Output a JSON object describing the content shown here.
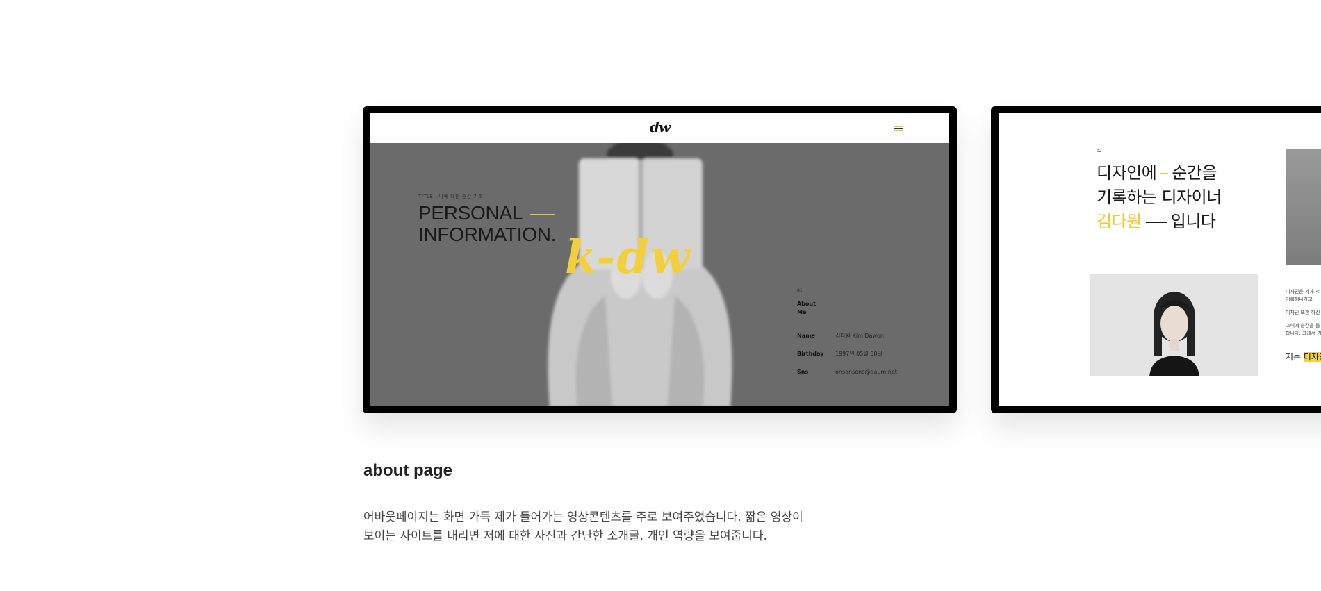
{
  "screen1": {
    "nav": {
      "logo": "dw",
      "menu_icon": "hamburger-menu-icon"
    },
    "hero": {
      "kicker": "TITLE . 나에 대한 순간 기록",
      "title_line1": "PERSONAL",
      "title_line2": "INFORMATION.",
      "logo_text": "k-dw"
    },
    "about": {
      "number": "01",
      "heading": "About Me",
      "rows": [
        {
          "key": "Name",
          "value": "김다원 Kim Dawon"
        },
        {
          "key": "Birthday",
          "value": "1997년 05월 08일"
        },
        {
          "key": "Sns",
          "value": "onsonsons@daum.net"
        }
      ]
    }
  },
  "screen2": {
    "number": "02",
    "headline": {
      "line1_a": "디자인에",
      "line1_b": "순간을",
      "line2": "기록하는 디자이너",
      "line3_name": "김다원",
      "line3_b": "입니다"
    },
    "body": [
      "디자인은 제게 <",
      "기록해나가고 ",
      "디자인 또한 하진",
      "그때에 순간을 틀",
      "합니다. 그래서 기"
    ],
    "strong_prefix": "저는",
    "strong_highlight": "디자인"
  },
  "caption": {
    "title": "about page",
    "line1": "어바웃페이지는 화면 가득 제가 들어가는 영상콘텐츠를 주로 보여주었습니다.  짧은 영상이",
    "line2": "보이는 사이트를 내리면 저에 대한 사진과 간단한 소개글, 개인 역량을 보여줍니다."
  },
  "colors": {
    "accent_yellow": "#f3cf3c",
    "hero_gray": "#6b6b6b",
    "frame": "#000000"
  }
}
